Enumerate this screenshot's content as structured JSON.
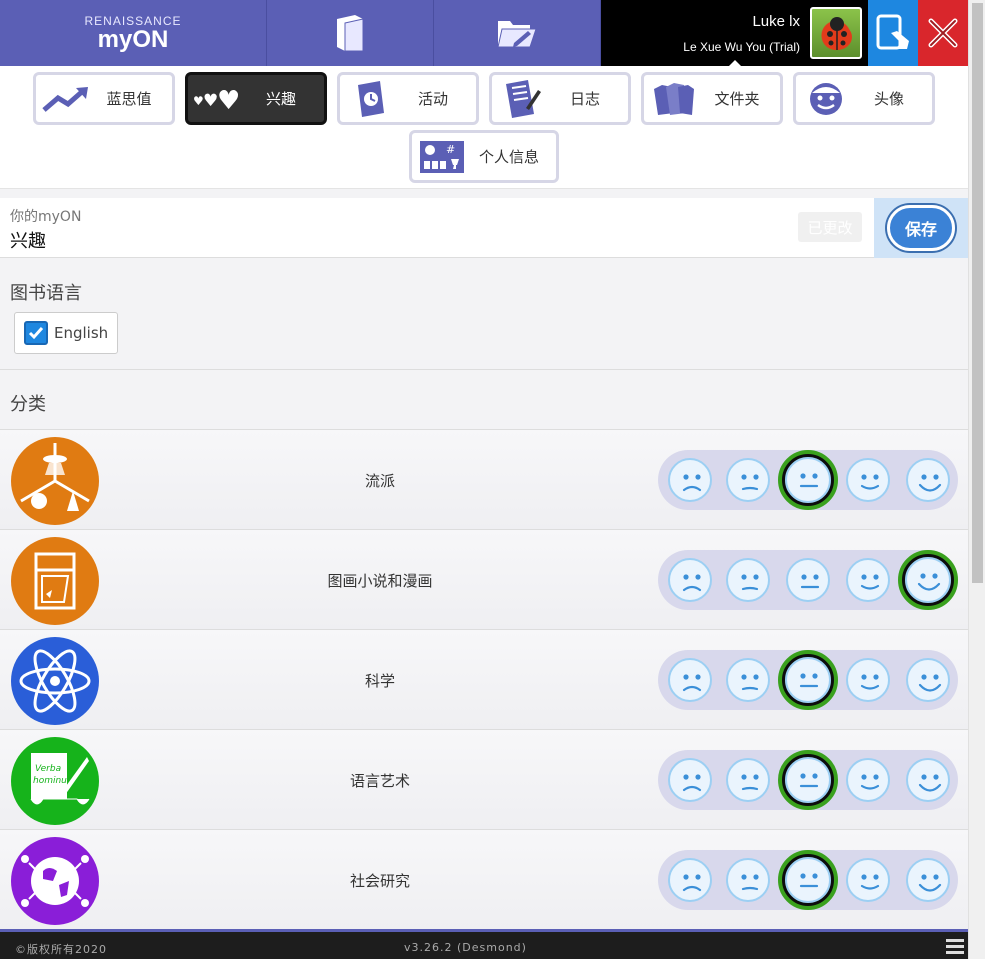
{
  "brand": {
    "super": "RENAISSANCE",
    "name": "myON"
  },
  "user": {
    "name": "Luke lx",
    "class_name": "Le Xue Wu You (Trial)"
  },
  "tabs": [
    {
      "label": "蓝思值",
      "icon": "trend-up-icon"
    },
    {
      "label": "兴趣",
      "icon": "hearts-icon"
    },
    {
      "label": "活动",
      "icon": "activity-book-icon"
    },
    {
      "label": "日志",
      "icon": "journal-icon"
    },
    {
      "label": "文件夹",
      "icon": "folders-icon"
    },
    {
      "label": "头像",
      "icon": "avatar-face-icon"
    },
    {
      "label": "个人信息",
      "icon": "profile-stats-icon"
    }
  ],
  "header": {
    "small": "你的myON",
    "title": "兴趣",
    "changed": "已更改",
    "save": "保存"
  },
  "language": {
    "title": "图书语言",
    "option": "English"
  },
  "categories_title": "分类",
  "categories": [
    {
      "label": "流派",
      "icon": "genres-icon",
      "color": "#e07b12",
      "rating": 3
    },
    {
      "label": "图画小说和漫画",
      "icon": "graphic-novel-icon",
      "color": "#e07b12",
      "rating": 5
    },
    {
      "label": "科学",
      "icon": "atom-icon",
      "color": "#2a5ed8",
      "rating": 3
    },
    {
      "label": "语言艺术",
      "icon": "scroll-quill-icon",
      "color": "#16b31b",
      "rating": 3
    },
    {
      "label": "社会研究",
      "icon": "globe-icon",
      "color": "#8a1ed8",
      "rating": 3
    }
  ],
  "footer": {
    "copyright": "©版权所有2020",
    "version": "v3.26.2 (Desmond)"
  },
  "colors": {
    "nav": "#5b5fb5",
    "accent": "#1e87e0",
    "exit": "#d9262c",
    "selected": "#3aa11e"
  }
}
